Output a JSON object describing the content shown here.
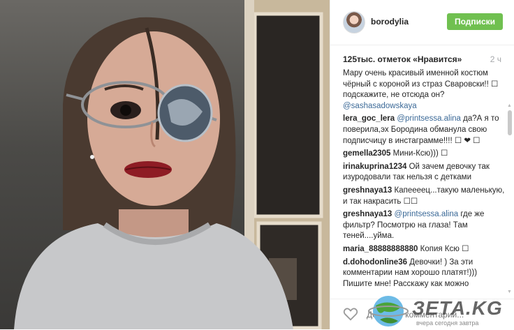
{
  "header": {
    "username": "borodylia",
    "follow_label": "Подписки"
  },
  "post": {
    "likes": "125тыс. отметок «Нравится»",
    "time": "2 ч"
  },
  "comments": [
    {
      "user": "",
      "mention": "",
      "text": "Мару очень красивый именной костюм чёрный с короной из страз Сваровски!! ☐ подскажите, не отсюда он?",
      "mention_after": "@sashasadowskaya"
    },
    {
      "user": "lera_goc_lera",
      "mention": "@printsessa.alina",
      "text": " да?А я то поверила,эх Бородина обманула свою подписчицу в инстаграмме!!!! ☐ ❤ ☐",
      "mention_after": ""
    },
    {
      "user": "gemella2305",
      "mention": "",
      "text": " Мини-Ксю))) ☐",
      "mention_after": ""
    },
    {
      "user": "irinakuprina1234",
      "mention": "",
      "text": " Ой зачем девочку так изуродовали так нельзя с детками",
      "mention_after": ""
    },
    {
      "user": "greshnaya13",
      "mention": "",
      "text": " Капеееец...такую маленькую, и так накрасить ☐☐",
      "mention_after": ""
    },
    {
      "user": "greshnaya13",
      "mention": "@printsessa.alina",
      "text": " где же фильтр? Посмотрю на глаза! Там теней....уйма.",
      "mention_after": ""
    },
    {
      "user": "maria_88888888880",
      "mention": "",
      "text": " Копия Ксю ☐",
      "mention_after": ""
    },
    {
      "user": "d.dohodonline36",
      "mention": "",
      "text": " Девочки! ) За эти комментарии нам хорошо платят!))) Пишите мне! Расскажу как можно",
      "mention_after": ""
    }
  ],
  "footer": {
    "comment_placeholder": "Добавьте комментарий..."
  },
  "watermark": {
    "text": "ЗЕТА.KG",
    "tagline": "вчера сегодня завтра"
  },
  "colors": {
    "follow_bg": "#70c050",
    "link": "#3b6997",
    "text": "#262626",
    "muted": "#a5a7aa"
  }
}
